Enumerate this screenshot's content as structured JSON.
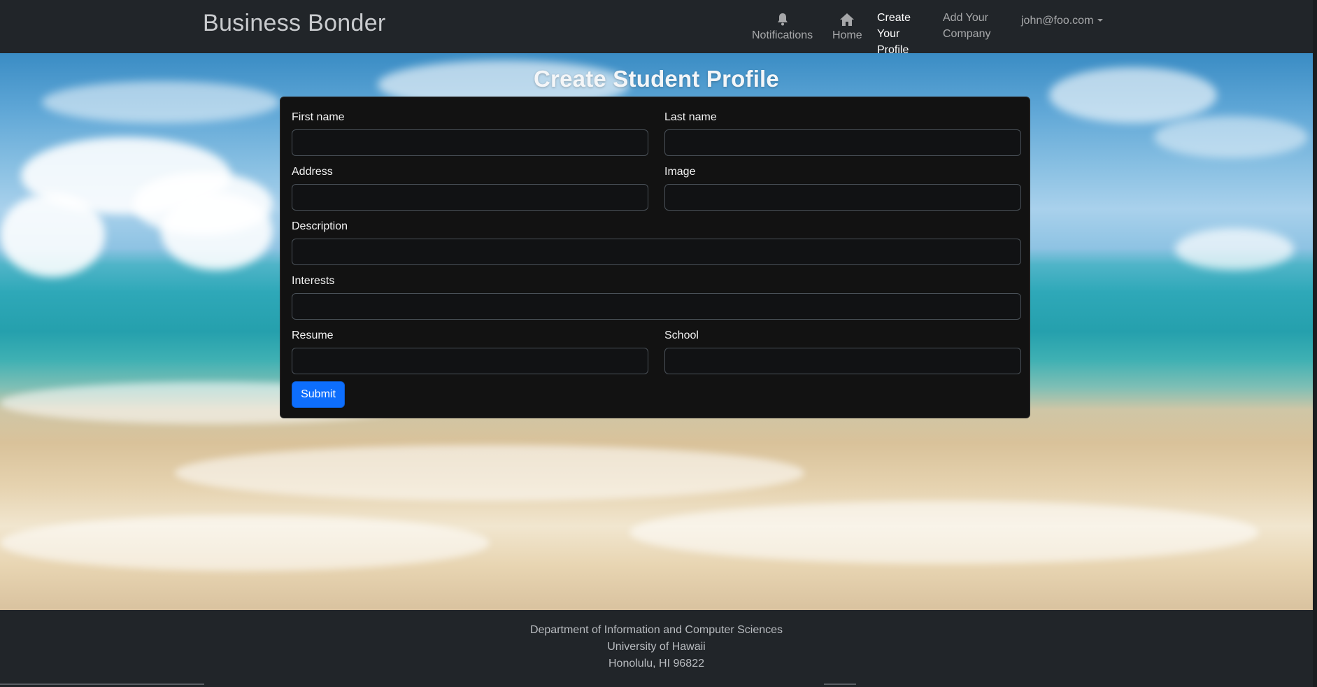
{
  "navbar": {
    "brand": "Business Bonder",
    "items": [
      {
        "label": "Notifications",
        "icon": "bell-icon",
        "active": false
      },
      {
        "label": "Home",
        "icon": "home-icon",
        "active": false
      },
      {
        "label": "Create Your Profile",
        "active": true
      },
      {
        "label": "Add Your Company",
        "active": false
      }
    ],
    "user": {
      "label": "john@foo.com"
    }
  },
  "page": {
    "title": "Create Student Profile"
  },
  "form": {
    "fields": {
      "first_name": {
        "label": "First name",
        "value": ""
      },
      "last_name": {
        "label": "Last name",
        "value": ""
      },
      "address": {
        "label": "Address",
        "value": ""
      },
      "image": {
        "label": "Image",
        "value": ""
      },
      "description": {
        "label": "Description",
        "value": ""
      },
      "interests": {
        "label": "Interests",
        "value": ""
      },
      "resume": {
        "label": "Resume",
        "value": ""
      },
      "school": {
        "label": "School",
        "value": ""
      }
    },
    "submit_label": "Submit"
  },
  "footer": {
    "line1": "Department of Information and Computer Sciences",
    "line2": "University of Hawaii",
    "line3": "Honolulu, HI 96822"
  },
  "colors": {
    "navbar_bg": "#212529",
    "card_bg": "#121212",
    "primary": "#0d6efd"
  }
}
